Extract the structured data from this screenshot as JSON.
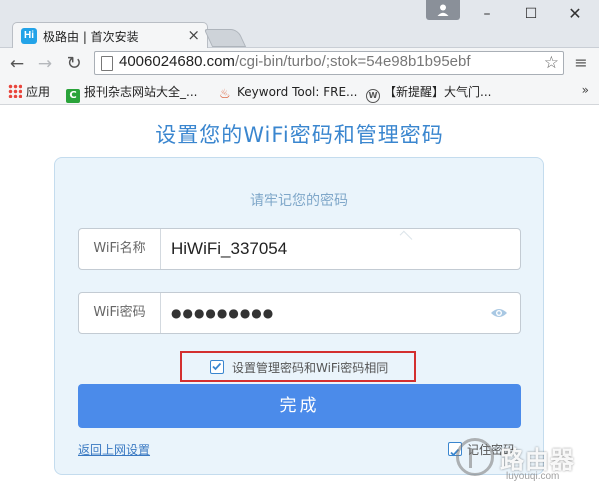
{
  "browser": {
    "tab_title": "极路由 | 首次安装",
    "tab_favicon_text": "Hi",
    "tab_close": "×",
    "url_main": "4006024680.com",
    "url_path": "/cgi-bin/turbo/;stok=54e98b1b95ebf",
    "window_controls": {
      "minimize": "–",
      "maximize": "☐",
      "close": "✕"
    },
    "bookmarks": [
      {
        "label": "应用",
        "icon": "apps-grid-icon"
      },
      {
        "label": "报刊杂志网站大全_...",
        "icon": "green-c-icon"
      },
      {
        "label": "Keyword Tool: FRE...",
        "icon": "flame-icon"
      },
      {
        "label": "【新提醒】大气门...",
        "icon": "wordpress-icon"
      }
    ],
    "bookmarks_more": "»"
  },
  "page": {
    "heading": "设置您的WiFi密码和管理密码",
    "subtitle": "请牢记您的密码",
    "ssid_label": "WiFi名称",
    "ssid_value": "HiWiFi_337054",
    "password_label": "WiFi密码",
    "password_masked": "●●●●●●●●●",
    "same_password_label": "设置管理密码和WiFi密码相同",
    "same_password_checked": true,
    "submit_label": "完成",
    "back_link": "返回上网设置",
    "remember_label": "记住密码",
    "accent_color": "#4b8bea",
    "highlight_color": "#d32f2f"
  },
  "watermark": {
    "text": "路由器",
    "sub": "luyouqi.com"
  }
}
